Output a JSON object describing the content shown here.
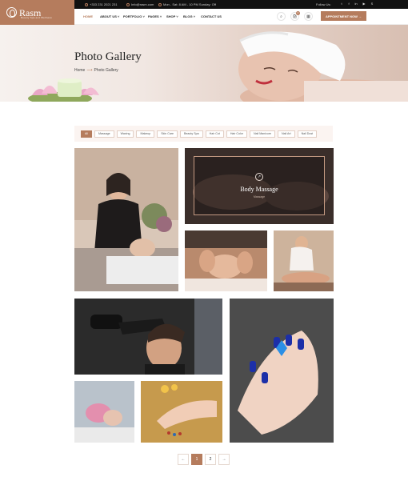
{
  "brand": {
    "name": "Rasm",
    "tagline": "Beauty Spa and Wellness"
  },
  "topbar": {
    "phone": "+333 231 2021 231",
    "email": "Info@rasm.com",
    "hours": "Mon - Sat: 8 AM - 10 PM Sunday: Off",
    "follow_label": "Follow Us:",
    "social_icons": [
      "twitter-icon",
      "facebook-icon",
      "linkedin-icon",
      "youtube-icon",
      "skype-icon"
    ]
  },
  "nav": {
    "items": [
      "HOME",
      "ABOUT US",
      "PORTFOLIO",
      "PAGES",
      "SHOP",
      "BLOG",
      "CONTACT US"
    ],
    "cart_count": "0",
    "cta": "APPOINTMENT NOW"
  },
  "hero": {
    "title": "Photo Gallery",
    "breadcrumb_home": "Home",
    "breadcrumb_current": "Photo Gallery"
  },
  "filters": [
    "All",
    "Massage",
    "Waxing",
    "Makeup",
    "Skin Care",
    "Beauty Spa",
    "Hair Cut",
    "Hair Color",
    "Nail Manicure",
    "Nail Art",
    "Nail Dust"
  ],
  "active_filter": "All",
  "overlay": {
    "title": "Body Massage",
    "category": "Massage"
  },
  "pagination": {
    "prev": "←",
    "pages": [
      "1",
      "2"
    ],
    "next": "→",
    "active": "1"
  },
  "colors": {
    "accent": "#b57c5d",
    "topbar": "#111111",
    "filter_bg": "#fbf4f1"
  }
}
